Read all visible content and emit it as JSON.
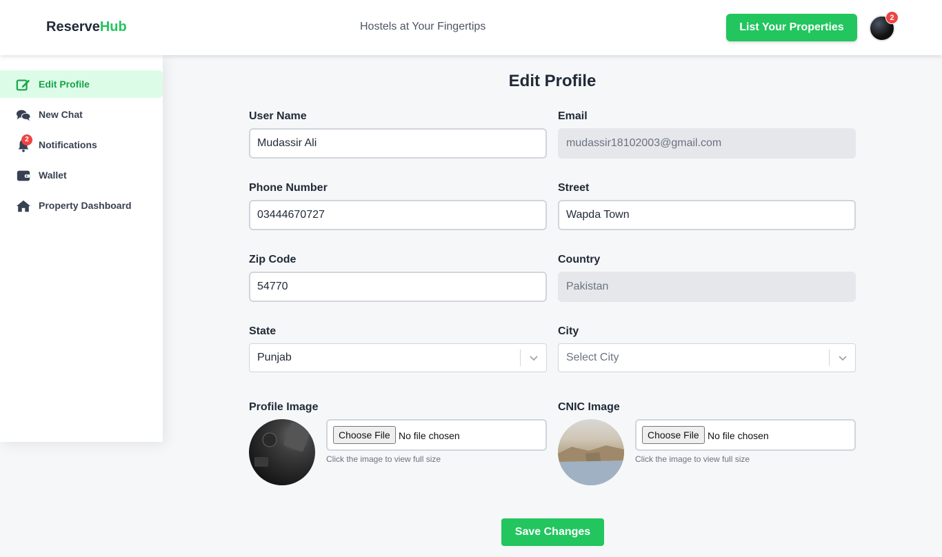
{
  "header": {
    "logo_prefix": "Reserve",
    "logo_suffix": "Hub",
    "tagline": "Hostels at Your Fingertips",
    "cta_label": "List Your Properties",
    "avatar_badge": "2"
  },
  "sidebar": {
    "items": [
      {
        "label": "Edit Profile",
        "icon": "edit-icon",
        "active": true
      },
      {
        "label": "New Chat",
        "icon": "chat-icon"
      },
      {
        "label": "Notifications",
        "icon": "bell-icon",
        "badge": "2"
      },
      {
        "label": "Wallet",
        "icon": "wallet-icon"
      },
      {
        "label": "Property Dashboard",
        "icon": "home-icon"
      }
    ]
  },
  "form": {
    "title": "Edit Profile",
    "username": {
      "label": "User Name",
      "value": "Mudassir Ali"
    },
    "email": {
      "label": "Email",
      "value": "mudassir18102003@gmail.com"
    },
    "phone": {
      "label": "Phone Number",
      "value": "03444670727"
    },
    "street": {
      "label": "Street",
      "value": "Wapda Town"
    },
    "zip": {
      "label": "Zip Code",
      "value": "54770"
    },
    "country": {
      "label": "Country",
      "value": "Pakistan"
    },
    "state": {
      "label": "State",
      "value": "Punjab"
    },
    "city": {
      "label": "City",
      "placeholder": "Select City"
    },
    "profile_image": {
      "label": "Profile Image",
      "button": "Choose File",
      "file_status": "No file chosen",
      "hint": "Click the image to view full size"
    },
    "cnic_image": {
      "label": "CNIC Image",
      "button": "Choose File",
      "file_status": "No file chosen",
      "hint": "Click the image to view full size"
    },
    "save_label": "Save Changes"
  },
  "colors": {
    "accent": "#22c55e",
    "badge": "#ef4444",
    "active_bg": "#dcfce7"
  }
}
